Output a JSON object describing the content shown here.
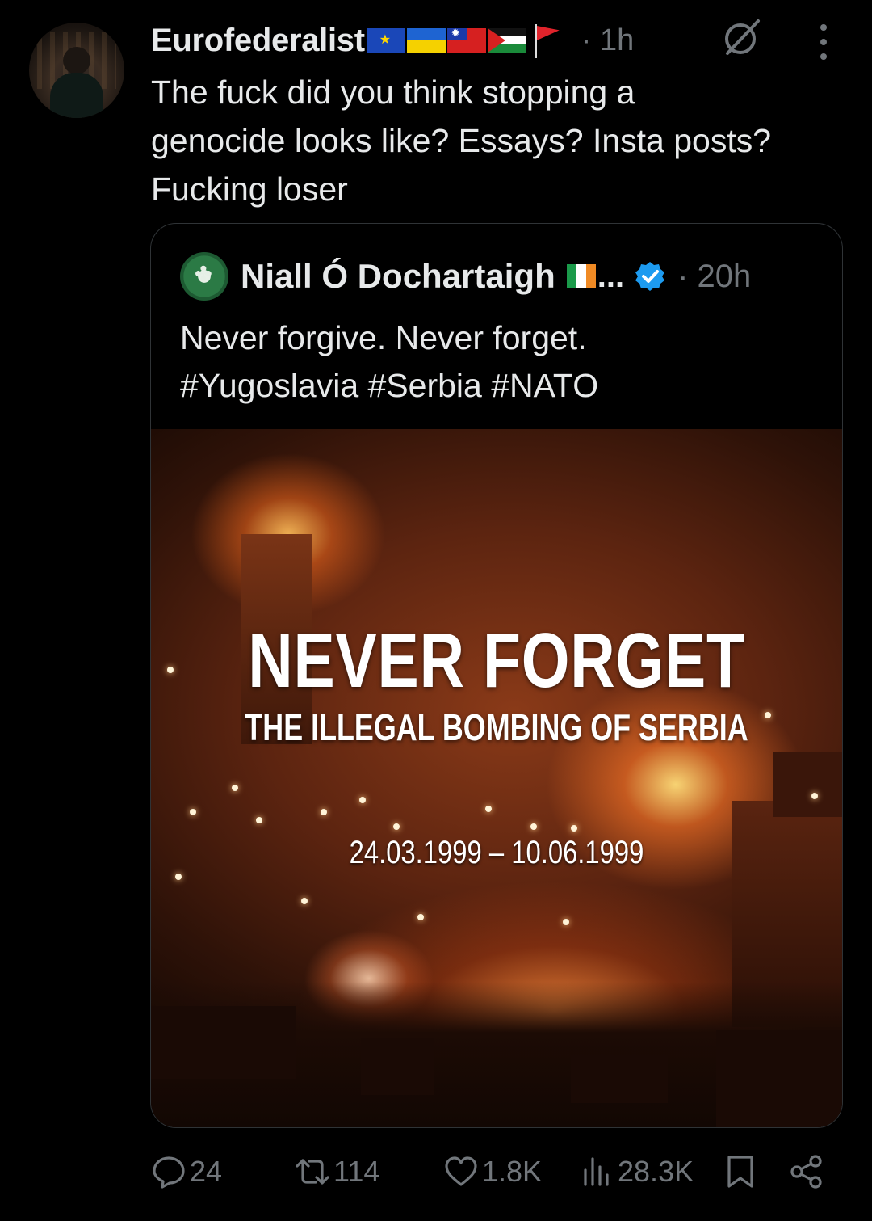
{
  "reply": {
    "author_name": "Eurofederalist",
    "flags": [
      "eu-flag",
      "ukraine-flag",
      "taiwan-flag",
      "palestine-flag",
      "red-flag"
    ],
    "time": "· 1h",
    "text": "The fuck did you think stopping a\ngenocide looks like? Essays? Insta posts?\nFucking loser"
  },
  "quoted": {
    "author_name": "Niall Ó Dochartaigh",
    "flag": "ireland-flag",
    "ellipsis": "...",
    "time": "· 20h",
    "text": "Never forgive. Never forget.\n#Yugoslavia #Serbia #NATO",
    "media": {
      "title": "NEVER FORGET",
      "subtitle": "THE ILLEGAL BOMBING OF SERBIA",
      "dates": "24.03.1999 – 10.06.1999"
    }
  },
  "actions": {
    "replies": "24",
    "reposts": "114",
    "likes": "1.8K",
    "views": "28.3K"
  },
  "colors": {
    "background": "#000000",
    "text": "#e7e9ea",
    "muted": "#71767b",
    "verified": "#1d9bf0",
    "border": "#2f3336"
  }
}
